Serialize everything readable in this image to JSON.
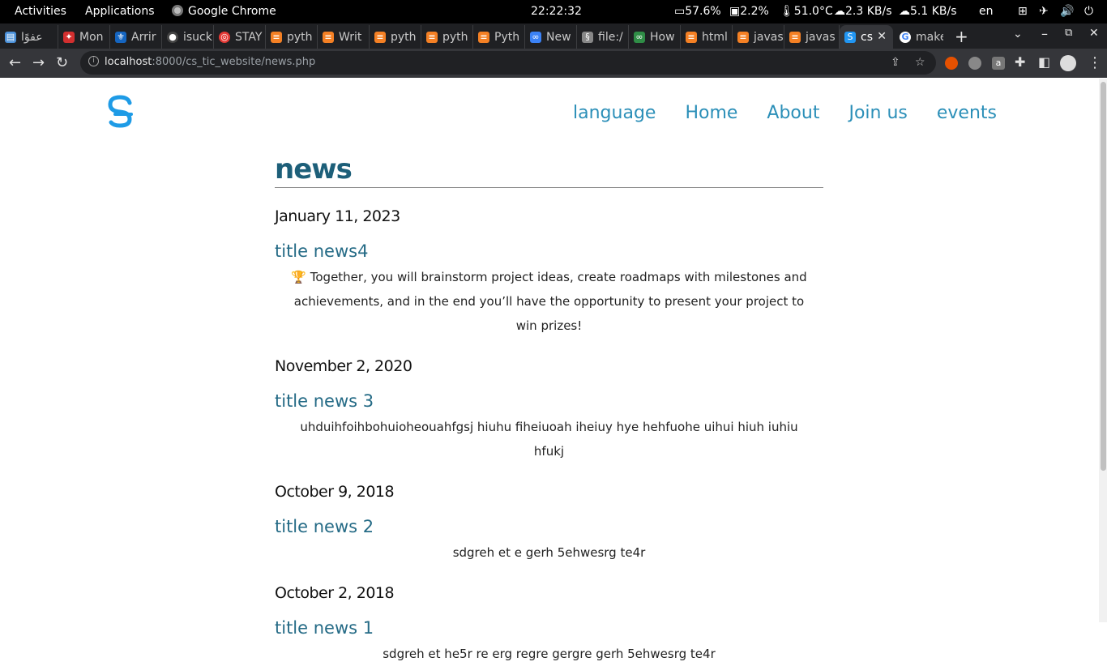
{
  "system_bar": {
    "activities": "Activities",
    "applications": "Applications",
    "app_name": "Google Chrome",
    "clock": "22:22:32",
    "battery": "57.6%",
    "cpu": "2.2%",
    "temp": "51.0°C",
    "download": "2.3 KB/s",
    "upload": "5.1 KB/s",
    "lang": "en"
  },
  "tabs": [
    {
      "label": "عفوًا",
      "icon": "page-icon",
      "color": "#4a90d9"
    },
    {
      "label": "Mon",
      "icon": "maple-leaf-icon",
      "color": "#d32f2f"
    },
    {
      "label": "Arrir",
      "icon": "fleur-de-lis-icon",
      "color": "#1565c0"
    },
    {
      "label": "isuck",
      "icon": "github-icon",
      "color": "#444"
    },
    {
      "label": "STAY",
      "icon": "target-icon",
      "color": "#e53935"
    },
    {
      "label": "pyth",
      "icon": "stackoverflow-icon",
      "color": "#f48024"
    },
    {
      "label": "Writ",
      "icon": "stackoverflow-icon",
      "color": "#f48024"
    },
    {
      "label": "pyth",
      "icon": "stackoverflow-icon",
      "color": "#f48024"
    },
    {
      "label": "pyth",
      "icon": "stackoverflow-icon",
      "color": "#f48024"
    },
    {
      "label": "Pyth",
      "icon": "stackoverflow-icon",
      "color": "#f48024"
    },
    {
      "label": "New",
      "icon": "replit-icon",
      "color": "#3b82f6"
    },
    {
      "label": "file:/",
      "icon": "file-icon",
      "color": "#888"
    },
    {
      "label": "How",
      "icon": "geeks-icon",
      "color": "#2f8d46"
    },
    {
      "label": "html",
      "icon": "stackoverflow-icon",
      "color": "#f48024"
    },
    {
      "label": "javas",
      "icon": "stackoverflow-icon",
      "color": "#f48024"
    },
    {
      "label": "javas",
      "icon": "stackoverflow-icon",
      "color": "#f48024"
    },
    {
      "label": "cs",
      "icon": "site-logo-icon",
      "color": "#2196f3",
      "active": true
    },
    {
      "label": "make",
      "icon": "google-icon",
      "color": "#4285f4"
    }
  ],
  "address_bar": {
    "host": "localhost",
    "port": ":8000",
    "path": "/cs_tic_website/news.php"
  },
  "site": {
    "nav": [
      "language",
      "Home",
      "About",
      "Join us",
      "events"
    ],
    "page_title": "news"
  },
  "news": [
    {
      "date": "January 11, 2023",
      "title": "title news4",
      "body": "🏆 Together, you will brainstorm project ideas, create roadmaps with milestones and achievements, and in the end you’ll have the opportunity to present your project to win prizes!"
    },
    {
      "date": "November 2, 2020",
      "title": "title news 3",
      "body": "uhduihfoihbohuioheouahfgsj hiuhu fiheiuoah iheiuy hye hehfuohe uihui hiuh iuhiu hfukj"
    },
    {
      "date": "October 9, 2018",
      "title": "title news 2",
      "body": "sdgreh et e gerh 5ehwesrg te4r"
    },
    {
      "date": "October 2, 2018",
      "title": "title news 1",
      "body": "sdgreh et he5r re erg regre gergre gerh 5ehwesrg te4r"
    }
  ],
  "colors": {
    "accent": "#2b8fb8",
    "title": "#1d5f79",
    "news_title": "#256b86"
  }
}
